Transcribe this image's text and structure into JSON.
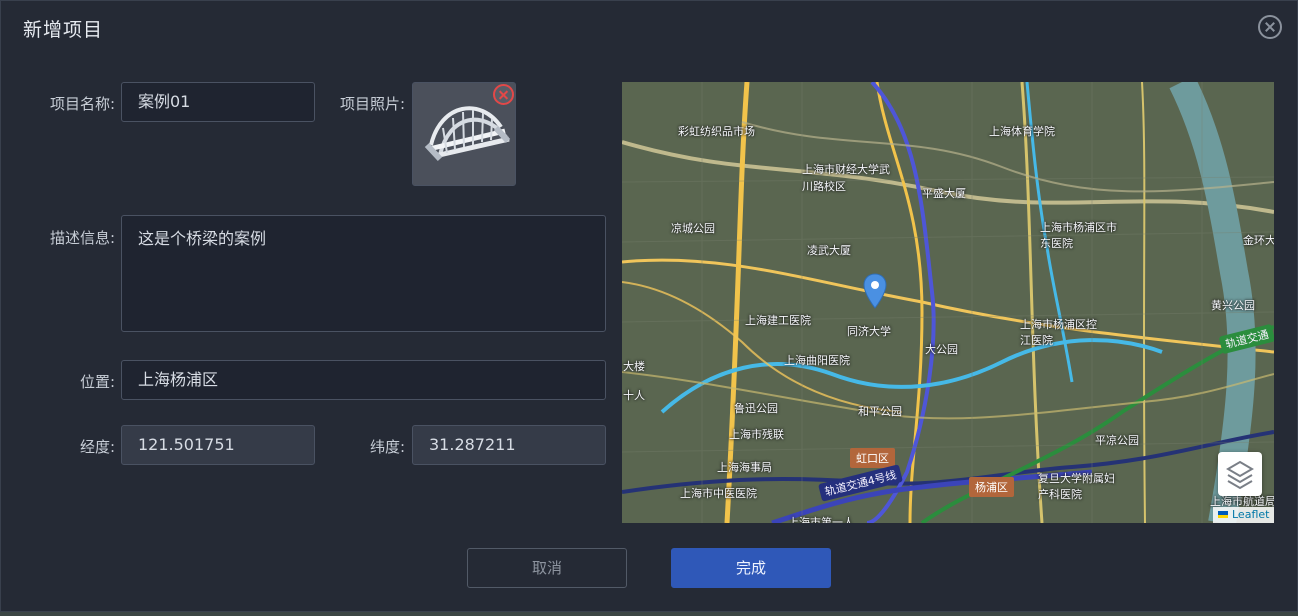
{
  "dialog": {
    "title": "新增项目",
    "close_icon": "close-circle-icon"
  },
  "form": {
    "name_label": "项目名称:",
    "name_value": "案例01",
    "photo_label": "项目照片:",
    "photo_icon": "bridge-image",
    "description_label": "描述信息:",
    "description_value": "这是个桥梁的案例",
    "location_label": "位置:",
    "location_value": "上海杨浦区",
    "longitude_label": "经度:",
    "longitude_value": "121.501751",
    "latitude_label": "纬度:",
    "latitude_value": "31.287211"
  },
  "map": {
    "pois": [
      "彩虹纺织品市场",
      "上海体育学院",
      "上海市财经大学武川路校区",
      "平盛大厦",
      "凉城公园",
      "凌武大厦",
      "上海市杨浦区市东医院",
      "上海建工医院",
      "同济大学",
      "上海曲阳医院",
      "上海市杨浦区控江医院",
      "黄兴公园",
      "鲁迅公园",
      "和平公园",
      "上海市残联",
      "上海海事局",
      "上海市中医医院",
      "复旦大学附属妇产科医院",
      "平凉公园",
      "金环大",
      "大楼",
      "十人",
      "上海市第一人",
      "上海市航道局",
      "大公园"
    ],
    "districts": [
      "虹口区",
      "杨浦区"
    ],
    "metro_labels": [
      "轨道交通4号线",
      "轨道交通"
    ],
    "layers_icon": "layers-icon",
    "attribution": "Leaflet",
    "colors": {
      "metro_purple": "#4e56d8",
      "metro_blue": "#46b9e7",
      "metro_green": "#3fa343",
      "road_yellow": "#f0c55b",
      "river": "#6e9b9d"
    }
  },
  "buttons": {
    "cancel": "取消",
    "done": "完成"
  }
}
